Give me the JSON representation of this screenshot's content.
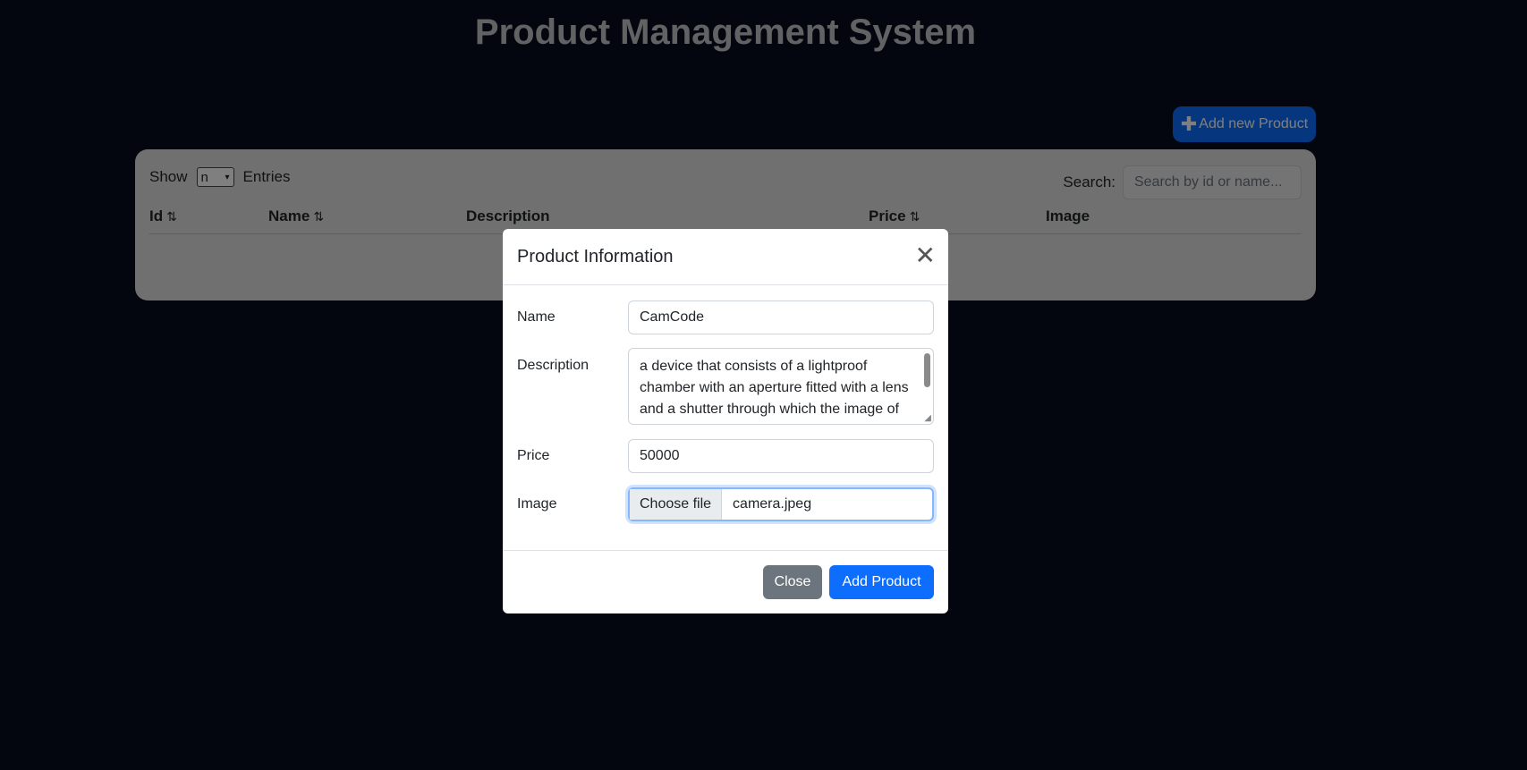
{
  "page": {
    "title": "Product Management System",
    "add_button_label": "Add new Product"
  },
  "table": {
    "show_label": "Show",
    "entries_value": "n",
    "entries_label": "Entries",
    "search_label": "Search:",
    "search_placeholder": "Search by id or name...",
    "columns": [
      "Id",
      "Name",
      "Description",
      "Price",
      "Image"
    ]
  },
  "modal": {
    "title": "Product Information",
    "fields": {
      "name_label": "Name",
      "name_value": "CamCode",
      "description_label": "Description",
      "description_value": "a device that consists of a lightproof chamber with an aperture fitted with a lens and a shutter through which the image of an object is projected onto a surface",
      "price_label": "Price",
      "price_value": "50000",
      "image_label": "Image",
      "choose_file_label": "Choose file",
      "file_name": "camera.jpeg"
    },
    "close_label": "Close",
    "add_label": "Add Product"
  },
  "colors": {
    "background": "#060c1c",
    "primary": "#0d6efd",
    "secondary": "#6c757d"
  }
}
